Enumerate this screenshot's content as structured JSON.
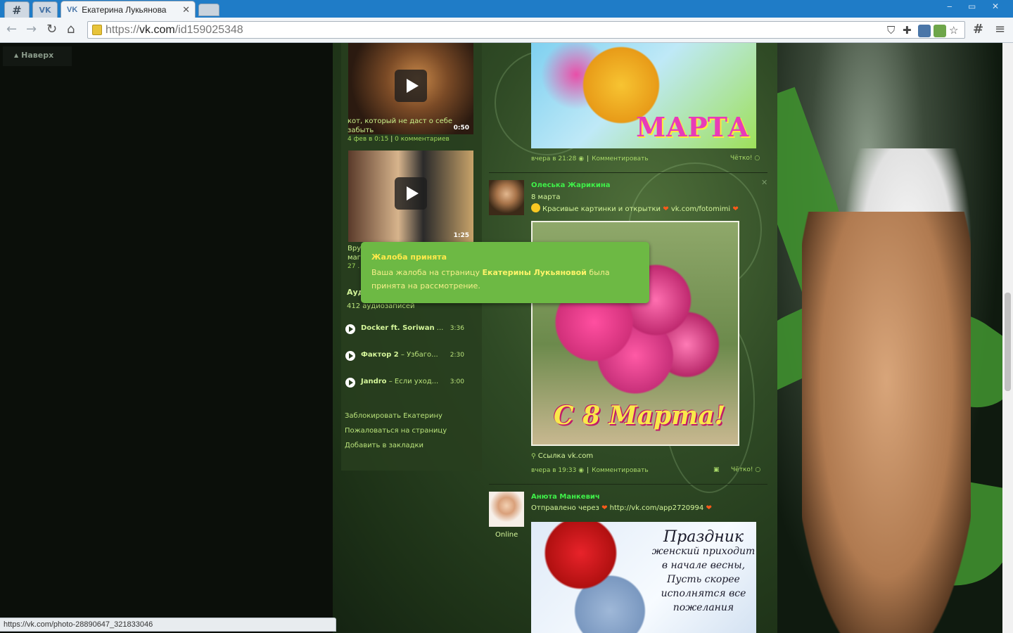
{
  "browser": {
    "tab_title": "Екатерина Лукьянова",
    "tab_brand": "VK",
    "url_secure": "https://",
    "url_host": "vk.com",
    "url_path": "/id159025348",
    "status_url": "https://vk.com/photo-28890647_321833046"
  },
  "page": {
    "to_top": "Наверх",
    "videos": [
      {
        "duration": "0:50",
        "title": "кот, который не даст о себе забыть",
        "date": "4 фев в 0:15",
        "comments": "0 комментариев"
      },
      {
        "duration": "1:25",
        "title": "Вру",
        "title2": "маг",
        "date": "27 ."
      }
    ],
    "audio": {
      "heading": "Ауд",
      "count": "412 аудиозаписей",
      "tracks": [
        {
          "artist": "Docker ft. Soriwan",
          "song": " ...",
          "time": "3:36"
        },
        {
          "artist": "Фактор 2",
          "song": " – Узбаго...",
          "time": "2:30"
        },
        {
          "artist": "Jandro",
          "song": " – Если уход...",
          "time": "3:00"
        }
      ]
    },
    "actions": [
      "Заблокировать Екатерину",
      "Пожаловаться на страницу",
      "Добавить в закладки"
    ],
    "posts": [
      {
        "image_text": "МАРТА",
        "time": "вчера в 21:28",
        "comment": "Комментировать",
        "like": "Чётко!"
      },
      {
        "author": "Олеська Жарикина",
        "text": "8 марта",
        "text2": "Красивые картинки и открытки",
        "link": "vk.com/fotomimi",
        "image_text": "С 8 Марта!",
        "link_label": "Ссылка vk.com",
        "time": "вчера в 19:33",
        "comment": "Комментировать",
        "like": "Чётко!"
      },
      {
        "author": "Анюта Манкевич",
        "via": "Отправлено через",
        "link": "http://vk.com/app2720994",
        "online": "Online",
        "image_lines": [
          "Праздник",
          "женский приходит",
          "в начале весны,",
          "Пусть скорее",
          "исполнятся все",
          "пожелания"
        ]
      }
    ]
  },
  "toast": {
    "title": "Жалоба принята",
    "line1_a": "Ваша жалоба на страницу ",
    "line1_b": "Екатерины Лукьяновой",
    "line1_c": " была",
    "line2": "принята на рассмотрение."
  }
}
